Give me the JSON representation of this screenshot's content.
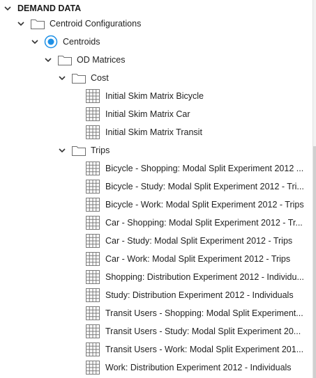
{
  "tree": {
    "root": {
      "label": "DEMAND DATA"
    },
    "centroid_configurations": {
      "label": "Centroid Configurations"
    },
    "centroids": {
      "label": "Centroids"
    },
    "od_matrices": {
      "label": "OD Matrices"
    },
    "cost": {
      "label": "Cost",
      "items": [
        "Initial Skim Matrix Bicycle",
        "Initial Skim Matrix Car",
        "Initial Skim Matrix Transit"
      ]
    },
    "trips": {
      "label": "Trips",
      "items": [
        "Bicycle - Shopping: Modal Split Experiment 2012 ...",
        "Bicycle - Study: Modal Split Experiment 2012 - Tri...",
        "Bicycle - Work: Modal Split Experiment 2012 - Trips",
        "Car - Shopping: Modal Split Experiment 2012 - Tr...",
        "Car - Study: Modal Split Experiment 2012 - Trips",
        "Car - Work: Modal Split Experiment 2012 - Trips",
        "Shopping: Distribution Experiment 2012 - Individu...",
        "Study: Distribution Experiment 2012 - Individuals",
        "Transit Users - Shopping: Modal Split Experiment...",
        "Transit Users - Study: Modal Split Experiment 20...",
        "Transit Users - Work: Modal Split Experiment 201...",
        "Work: Distribution Experiment 2012 - Individuals"
      ]
    }
  },
  "icons": {
    "expand": "chevron-down-icon",
    "folder": "folder-icon",
    "centroid": "radio-dot-icon",
    "matrix": "grid-matrix-icon"
  },
  "colors": {
    "accent": "#1e90e6",
    "folder_stroke": "#6e6e6e",
    "grid_stroke": "#7a7a7a"
  }
}
